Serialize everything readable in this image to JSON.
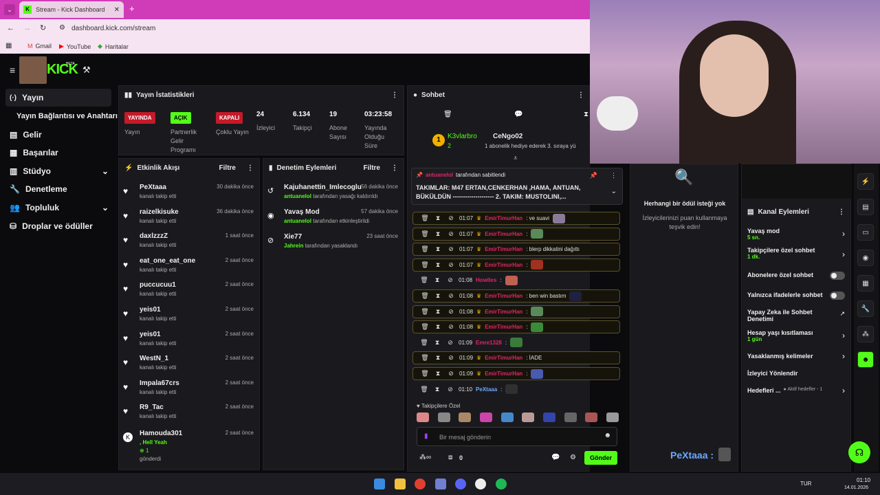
{
  "browser": {
    "tab_title": "Stream - Kick Dashboard",
    "url": "dashboard.kick.com/stream",
    "bookmarks": [
      "Gmail",
      "YouTube",
      "Haritalar"
    ]
  },
  "brand": {
    "logo": "KICK",
    "beta": "BETA",
    "accent": "#53fc18"
  },
  "sidebar": {
    "items": [
      {
        "label": "Yayın",
        "icon": "broadcast-icon"
      },
      {
        "label": "Yayın Bağlantısı ve Anahtarı"
      },
      {
        "label": "Gelir",
        "icon": "revenue-icon"
      },
      {
        "label": "Başarılar",
        "icon": "achievements-icon"
      },
      {
        "label": "Stüdyo",
        "icon": "studio-icon"
      },
      {
        "label": "Denetleme",
        "icon": "wrench-icon"
      },
      {
        "label": "Topluluk",
        "icon": "community-icon"
      },
      {
        "label": "Droplar ve ödüller",
        "icon": "drops-icon"
      }
    ]
  },
  "stats": {
    "title": "Yayın İstatistikleri",
    "yayin_badge": "YAYINDA",
    "yayin_label": "Yayın",
    "partner_badge": "AÇIK",
    "partner_label": "Partnerlik Gelir Programı",
    "multi_badge": "KAPALI",
    "multi_label": "Çoklu Yayın",
    "viewers": "24",
    "viewers_label": "İzleyici",
    "followers": "6.134",
    "followers_label": "Takipçi",
    "subs": "19",
    "subs_label": "Abone Sayısı",
    "uptime": "03:23:58",
    "uptime_label": "Yayında Olduğu Süre"
  },
  "activity": {
    "title": "Etkinlik Akışı",
    "filter": "Filtre",
    "items": [
      {
        "name": "PeXtaaa",
        "sub": "kanalı takip etti",
        "time": "30 dakika önce"
      },
      {
        "name": "raizelkisuke",
        "sub": "kanalı takip etti",
        "time": "36 dakika önce"
      },
      {
        "name": "daxlzzzZ",
        "sub": "kanalı takip etti",
        "time": "1 saat önce"
      },
      {
        "name": "eat_one_eat_one",
        "sub": "kanalı takip etti",
        "time": "2 saat önce"
      },
      {
        "name": "puccucuu1",
        "sub": "kanalı takip etti",
        "time": "2 saat önce"
      },
      {
        "name": "yeis01",
        "sub": "kanalı takip etti",
        "time": "2 saat önce"
      },
      {
        "name": "yeis01",
        "sub": "kanalı takip etti",
        "time": "2 saat önce"
      },
      {
        "name": "WestN_1",
        "sub": "kanalı takip etti",
        "time": "2 saat önce"
      },
      {
        "name": "Impala67crs",
        "sub": "kanalı takip etti",
        "time": "2 saat önce"
      },
      {
        "name": "R9_Tac",
        "sub": "kanalı takip etti",
        "time": "2 saat önce"
      }
    ],
    "last": {
      "name": "Hamouda301",
      "msg": ", Hell Yeah",
      "count": "1",
      "sub": "gönderdi",
      "time": "2 saat önce"
    }
  },
  "moderation": {
    "title": "Denetim Eylemleri",
    "filter": "Filtre",
    "items": [
      {
        "name": "Kajuhanettin_Imlecoglu",
        "actor": "antuanelol",
        "text": "tarafından yasağı kaldırıldı",
        "time": "56 dakika önce"
      },
      {
        "name": "Yavaş Mod",
        "actor": "antuanelol",
        "text": "tarafından etkinleştirildi",
        "time": "57 dakika önce"
      },
      {
        "name": "Xie77",
        "actor": "Jahrein",
        "text": "tarafından yasaklandı",
        "time": "23 saat önce"
      }
    ]
  },
  "chat": {
    "title": "Sohbet",
    "leader": {
      "rank": "1",
      "name": "K3vlarbro",
      "count": "2"
    },
    "gift": {
      "name": "CeNgo02",
      "text": "1 abonelik hediye ederek 3. sıraya yü"
    },
    "pinned": {
      "by": "antuanelol",
      "by_text": "tarafından sabitlendi",
      "text": "TAKIMLAR: M47 ERTAN,CENKERHAN ,HAMA, ANTUAN, BÜKÜLDÜN -------------------- 2. TAKIM: MUSTOLINI,..."
    },
    "messages": [
      {
        "time": "01:07",
        "user": "EmirTimurHan",
        "text": ": ve suavi",
        "color": "#e0246b"
      },
      {
        "time": "01:07",
        "user": "EmirTimurHan",
        "text": ":",
        "color": "#e0246b"
      },
      {
        "time": "01:07",
        "user": "EmirTimurHan",
        "text": ": blerp dikkatini dağıttı",
        "color": "#e0246b"
      },
      {
        "time": "01:07",
        "user": "EmirTimurHan",
        "text": ":",
        "color": "#e0246b"
      },
      {
        "time": "01:08",
        "user": "Howlles",
        "text": ":",
        "color": "#e0246b"
      },
      {
        "time": "01:08",
        "user": "EmirTimurHan",
        "text": ": ben win bastım",
        "color": "#e0246b"
      },
      {
        "time": "01:08",
        "user": "EmirTimurHan",
        "text": ":",
        "color": "#e0246b"
      },
      {
        "time": "01:08",
        "user": "EmirTimurHan",
        "text": ":",
        "color": "#e0246b"
      },
      {
        "time": "01:09",
        "user": "Emre1328",
        "text": ":",
        "color": "#e0246b"
      },
      {
        "time": "01:09",
        "user": "EmirTimurHan",
        "text": ": İADE",
        "color": "#e0246b"
      },
      {
        "time": "01:09",
        "user": "EmirTimurHan",
        "text": ":",
        "color": "#e0246b"
      },
      {
        "time": "01:10",
        "user": "PeXtaaa",
        "text": ":",
        "color": "#6fa8ff"
      }
    ],
    "followers_only": "Takipçilere Özel",
    "input_placeholder": "Bir mesaj gönderin",
    "points": "0",
    "send": "Gönder"
  },
  "rewards": {
    "empty_title": "Herhangi bir ödül isteği yok",
    "empty_sub": "İzleyicilerinizi puan kullanmaya teşvik edin!"
  },
  "channel_actions": {
    "title": "Kanal Eylemleri",
    "items": [
      {
        "label": "Yavaş mod",
        "sub": "5 sn."
      },
      {
        "label": "Takipçilere özel sohbet",
        "sub": "1 dk."
      },
      {
        "label": "Abonelere özel sohbet",
        "sub": ""
      },
      {
        "label": "Yalnızca ifadelerle sohbet",
        "sub": ""
      },
      {
        "label": "Yapay Zeka ile Sohbet Denetimi",
        "sub": ""
      },
      {
        "label": "Hesap yaşı kısıtlaması",
        "sub": "1 gün"
      },
      {
        "label": "Yasaklanmış kelimeler",
        "sub": ""
      },
      {
        "label": "İzleyici Yönlendir",
        "sub": ""
      },
      {
        "label": "Hedefleri ...",
        "sub": "Aktif hedefler - 1"
      }
    ]
  },
  "overlay_name": "PeXtaaa :",
  "taskbar": {
    "lang": "TUR",
    "time": "01:10",
    "date": "14.01.2026"
  }
}
